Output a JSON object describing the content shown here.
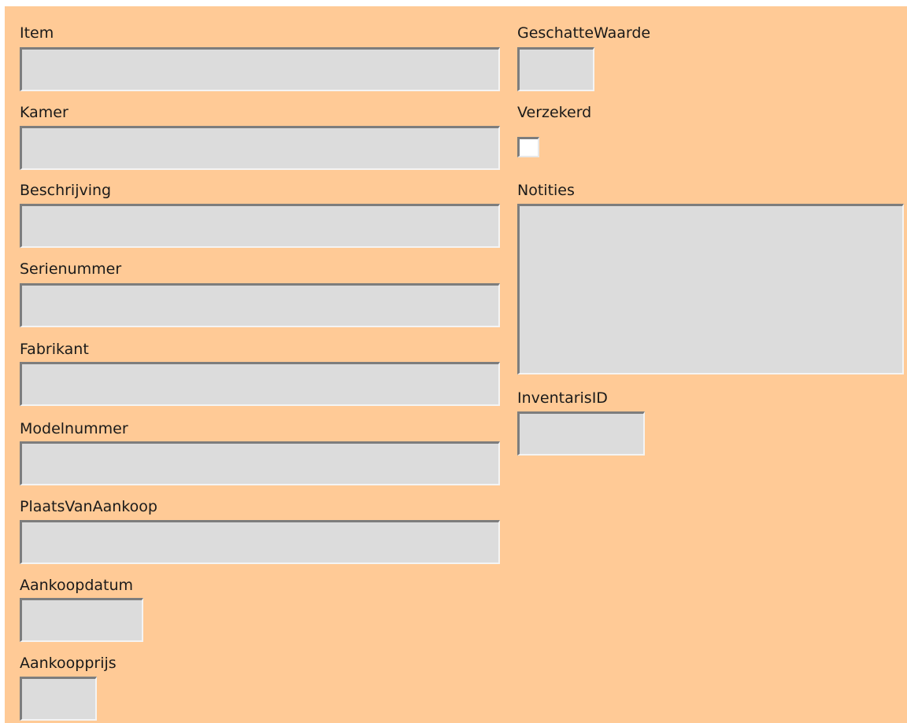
{
  "form": {
    "left_fields": [
      {
        "label": "Item",
        "value": ""
      },
      {
        "label": "Kamer",
        "value": ""
      },
      {
        "label": "Beschrijving",
        "value": ""
      },
      {
        "label": "Serienummer",
        "value": ""
      },
      {
        "label": "Fabrikant",
        "value": ""
      },
      {
        "label": "Modelnummer",
        "value": ""
      },
      {
        "label": "PlaatsVanAankoop",
        "value": ""
      },
      {
        "label": "Aankoopdatum",
        "value": ""
      },
      {
        "label": "Aankoopprijs",
        "value": ""
      }
    ],
    "geschatte_waarde": {
      "label": "GeschatteWaarde",
      "value": ""
    },
    "verzekerd": {
      "label": "Verzekerd",
      "checked": false
    },
    "notities": {
      "label": "Notities",
      "value": ""
    },
    "inventaris_id": {
      "label": "InventarisID",
      "value": ""
    }
  },
  "colors": {
    "form_background": "#ffca96",
    "field_background": "#dcdcdc"
  }
}
